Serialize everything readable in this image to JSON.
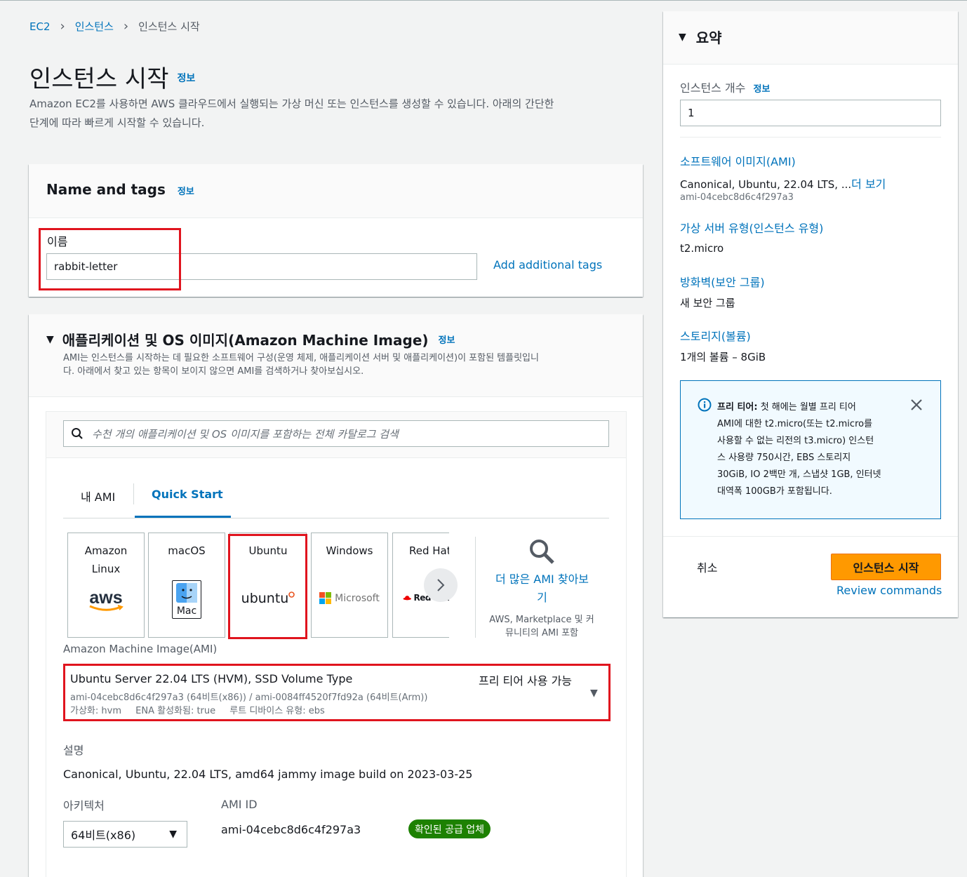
{
  "breadcrumb": {
    "root": "EC2",
    "parent": "인스턴스",
    "current": "인스턴스 시작"
  },
  "page": {
    "title": "인스턴스 시작",
    "info": "정보",
    "desc_line1": "Amazon EC2를 사용하면 AWS 클라우드에서 실행되는 가상 머신 또는 인스턴스를 생성할 수 있습니다. 아래의 간단한",
    "desc_line2": "단계에 따라 빠르게 시작할 수 있습니다."
  },
  "name_tags": {
    "title": "Name and tags",
    "info": "정보",
    "name_label": "이름",
    "name_value": "rabbit-letter",
    "add_tags": "Add additional tags"
  },
  "ami_section": {
    "title": "애플리케이션 및 OS 이미지(Amazon Machine Image)",
    "info": "정보",
    "desc_line1": "AMI는 인스턴스를 시작하는 데 필요한 소프트웨어 구성(운영 체제, 애플리케이션 서버 및 애플리케이션)이 포함된 템플릿입니",
    "desc_line2": "다. 아래에서 찾고 있는 항목이 보이지 않으면 AMI를 검색하거나 찾아보십시오.",
    "search_placeholder": "수천 개의 애플리케이션 및 OS 이미지를 포함하는 전체 카탈로그 검색",
    "tabs": {
      "my_ami": "내 AMI",
      "quick_start": "Quick Start"
    },
    "os": {
      "amazon_1": "Amazon",
      "amazon_2": "Linux",
      "amazon_logo": "aws",
      "macos": "macOS",
      "mac_logo": "Mac",
      "ubuntu": "Ubuntu",
      "ubuntu_logo": "ubuntu",
      "windows": "Windows",
      "windows_logo": "Microsoft",
      "redhat": "Red Hat",
      "redhat_logo": "Red Hat"
    },
    "browse_line1": "더 많은 AMI 찾아보",
    "browse_line2": "기",
    "browse_sub1": "AWS, Marketplace 및 커",
    "browse_sub2": "뮤니티의 AMI 포함",
    "ami_label": "Amazon Machine Image(AMI)",
    "ami_name": "Ubuntu Server 22.04 LTS (HVM), SSD Volume Type",
    "ami_free": "프리 티어 사용 가능",
    "ami_ids": "ami-04cebc8d6c4f297a3 (64비트(x86)) / ami-0084ff4520f7fd92a (64비트(Arm))",
    "ami_virt": "가상화: hvm",
    "ami_ena": "ENA 활성화됨: true",
    "ami_root": "루트 디바이스 유형: ebs",
    "desc_label": "설명",
    "desc_value": "Canonical, Ubuntu, 22.04 LTS, amd64 jammy image build on 2023-03-25",
    "arch_label": "아키텍처",
    "arch_value": "64비트(x86)",
    "amiid_label": "AMI ID",
    "amiid_value": "ami-04cebc8d6c4f297a3",
    "verified": "확인된 공급 업체"
  },
  "summary": {
    "title": "요약",
    "count_label": "인스턴스 개수",
    "info": "정보",
    "count_value": "1",
    "ami_label": "소프트웨어 이미지(AMI)",
    "ami_value": "Canonical, Ubuntu, 22.04 LTS, ...",
    "ami_more": "더 보기",
    "ami_id": "ami-04cebc8d6c4f297a3",
    "type_label": "가상 서버 유형(인스턴스 유형)",
    "type_value": "t2.micro",
    "fw_label": "방화벽(보안 그룹)",
    "fw_value": "새 보안 그룹",
    "storage_label": "스토리지(볼륨)",
    "storage_value": "1개의 볼륨 – 8GiB",
    "free_bold": "프리 티어:",
    "free_l1": " 첫 해에는 월별 프리 티어",
    "free_l2": "AMI에 대한 t2.micro(또는 t2.micro를",
    "free_l3": "사용할 수 없는 리전의 t3.micro) 인스턴",
    "free_l4": "스 사용량 750시간, EBS 스토리지",
    "free_l5": "30GiB, IO 2백만 개, 스냅샷 1GB, 인터넷",
    "free_l6": "대역폭 100GB가 포함됩니다.",
    "cancel": "취소",
    "launch": "인스턴스 시작",
    "review": "Review commands"
  },
  "colors": {
    "accent": "#0073bb",
    "launch_button": "#ff9900",
    "highlight": "#e0141e",
    "verified": "#1d8102"
  }
}
